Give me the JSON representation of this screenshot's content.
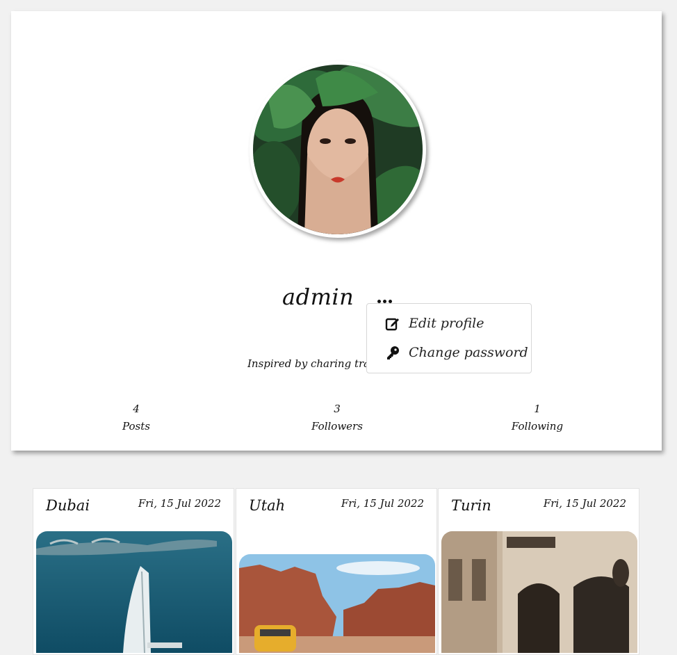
{
  "profile": {
    "username": "admin",
    "bio": "Inspired by charing trav",
    "avatar_alt": "profile photo"
  },
  "menu": {
    "items": [
      {
        "label": "Edit profile",
        "icon": "edit-icon"
      },
      {
        "label": "Change password",
        "icon": "key-icon"
      }
    ]
  },
  "stats": [
    {
      "value": "4",
      "label": "Posts"
    },
    {
      "value": "3",
      "label": "Followers"
    },
    {
      "value": "1",
      "label": "Following"
    }
  ],
  "posts": [
    {
      "title": "Dubai",
      "date": "Fri, 15 Jul 2022"
    },
    {
      "title": "Utah",
      "date": "Fri, 15 Jul 2022"
    },
    {
      "title": "Turin",
      "date": "Fri, 15 Jul 2022"
    }
  ]
}
